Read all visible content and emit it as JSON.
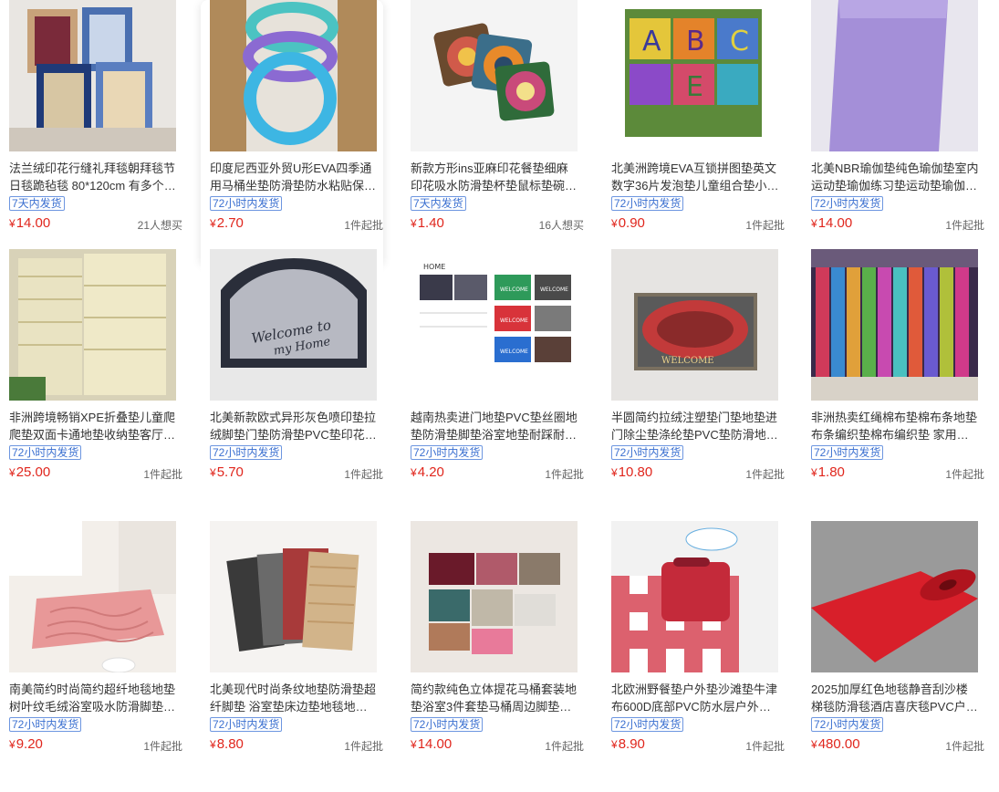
{
  "currency": "¥",
  "products": [
    {
      "title": "法兰绒印花行缝礼拜毯朝拜毯节日毯跪毡毯 80*120cm 有多个…",
      "badge": "7天内发货",
      "price": "14.00",
      "sold": "21人想买",
      "image": "prayer-rug-stack-image"
    },
    {
      "title": "印度尼西亚外贸U形EVA四季通用马桶坐垫防滑垫防水粘贴保…",
      "badge": "72小时内发货",
      "price": "2.70",
      "sold": "1件起批",
      "image": "toilet-seat-cover-image"
    },
    {
      "title": "新款方形ins亚麻印花餐垫细麻印花吸水防滑垫杯垫鼠标垫碗垫…",
      "badge": "7天内发货",
      "price": "1.40",
      "sold": "16人想买",
      "image": "printed-placemat-image"
    },
    {
      "title": "北美洲跨境EVA互锁拼图垫英文数字36片发泡垫儿童组合垫小…",
      "badge": "72小时内发货",
      "price": "0.90",
      "sold": "1件起批",
      "image": "eva-puzzle-mat-image"
    },
    {
      "title": "北美NBR瑜伽垫纯色瑜伽垫室内运动垫瑜伽练习垫运动垫瑜伽…",
      "badge": "72小时内发货",
      "price": "14.00",
      "sold": "1件起批",
      "image": "yoga-mat-image"
    },
    {
      "title": "非洲跨境畅销XPE折叠垫儿童爬爬垫双面卡通地垫收纳垫客厅…",
      "badge": "72小时内发货",
      "price": "25.00",
      "sold": "1件起批",
      "image": "folding-play-mat-image"
    },
    {
      "title": "北美新款欧式异形灰色喷印垫拉绒脚垫门垫防滑垫PVC垫印花…",
      "badge": "72小时内发货",
      "price": "5.70",
      "sold": "1件起批",
      "image": "welcome-door-mat-image"
    },
    {
      "title": "越南热卖进门地垫PVC垫丝圈地垫防滑垫脚垫浴室地垫耐踩耐…",
      "badge": "72小时内发货",
      "price": "4.20",
      "sold": "1件起批",
      "image": "pvc-coil-mat-image"
    },
    {
      "title": "半圆简约拉绒注塑垫门垫地垫进门除尘垫涤纶垫PVC垫防滑地…",
      "badge": "72小时内发货",
      "price": "10.80",
      "sold": "1件起批",
      "image": "red-welcome-mat-image"
    },
    {
      "title": "非洲热卖红绳棉布垫棉布条地垫布条编织垫棉布编织垫 家用垫…",
      "badge": "72小时内发货",
      "price": "1.80",
      "sold": "1件起批",
      "image": "cotton-rag-rug-image"
    },
    {
      "title": "南美简约时尚简约超纤地毯地垫树叶纹毛绒浴室吸水防滑脚垫 …",
      "badge": "72小时内发货",
      "price": "9.20",
      "sold": "1件起批",
      "image": "pink-bath-mat-image"
    },
    {
      "title": "北美现代时尚条纹地垫防滑垫超纤脚垫 浴室垫床边垫地毯地垫…",
      "badge": "72小时内发货",
      "price": "8.80",
      "sold": "1件起批",
      "image": "striped-mat-image"
    },
    {
      "title": "简约款纯色立体提花马桶套装地垫浴室3件套垫马桶周边脚垫脚…",
      "badge": "72小时内发货",
      "price": "14.00",
      "sold": "1件起批",
      "image": "bath-mat-set-image"
    },
    {
      "title": "北欧洲野餐垫户外垫沙滩垫牛津布600D底部PVC防水层户外坐…",
      "badge": "72小时内发货",
      "price": "8.90",
      "sold": "1件起批",
      "image": "picnic-mat-image"
    },
    {
      "title": "2025加厚红色地毯静音刮沙楼梯毯防滑毯酒店喜庆毯PVC户外…",
      "badge": "72小时内发货",
      "price": "480.00",
      "sold": "1件起批",
      "image": "red-carpet-roll-image"
    }
  ],
  "image_text": {
    "welcome": "WELCOME",
    "script_line1": "Welcome to",
    "script_line2": "my Home",
    "home": "HOME",
    "puzzle_letters": [
      "A",
      "B",
      "C",
      "E"
    ]
  }
}
